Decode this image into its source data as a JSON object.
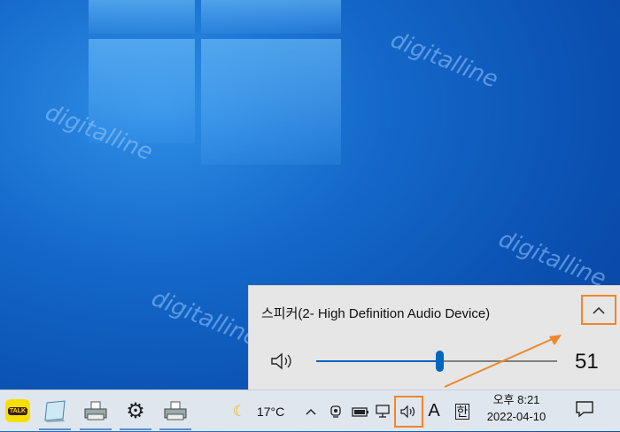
{
  "watermark": [
    "digitalline",
    "digitalline",
    "digitalline",
    "digitalline"
  ],
  "flyout": {
    "device_label": "스피커(2- High Definition Audio Device)",
    "volume": 51,
    "volume_text": "51"
  },
  "taskbar": {
    "apps": [
      "kakaotalk-icon",
      "notepad-icon",
      "printer-icon",
      "settings-icon",
      "printer-icon"
    ],
    "kakao_label": "TALK",
    "weather": {
      "icon": "moon-icon",
      "temperature": "17°C"
    },
    "input_mode": "A",
    "ime": "한",
    "clock": {
      "time": "오후 8:21",
      "date": "2022-04-10"
    }
  },
  "colors": {
    "highlight": "#f0862a",
    "accent": "#0067c0",
    "taskbar_bg": "#dfe6ee"
  }
}
